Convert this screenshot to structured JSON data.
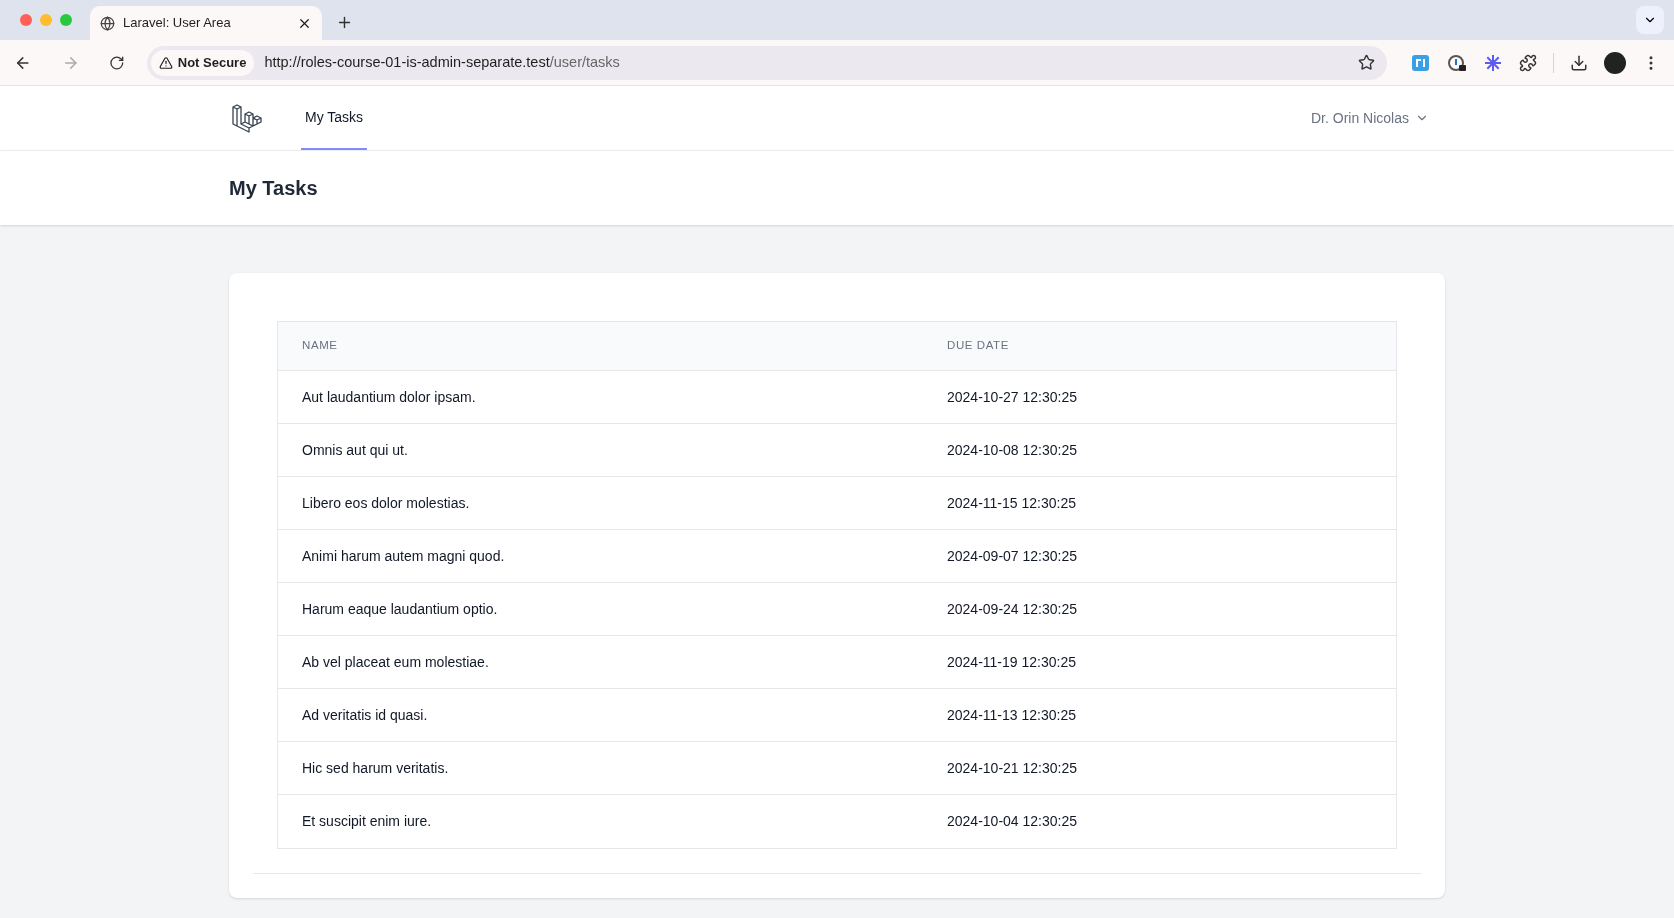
{
  "browser": {
    "tabs": [
      {
        "title": "Laravel: User Area",
        "selected": true
      }
    ],
    "security_label": "Not Secure",
    "url_host": "http://roles-course-01-is-admin-separate.test",
    "url_path": "/user/tasks"
  },
  "nav": {
    "links": [
      {
        "label": "My Tasks",
        "selected": true
      }
    ],
    "user_menu": "Dr. Orin Nicolas"
  },
  "page_title": "My Tasks",
  "table": {
    "columns": [
      "NAME",
      "DUE DATE"
    ],
    "rows": [
      [
        "Aut laudantium dolor ipsam.",
        "2024-10-27 12:30:25"
      ],
      [
        "Omnis aut qui ut.",
        "2024-10-08 12:30:25"
      ],
      [
        "Libero eos dolor molestias.",
        "2024-11-15 12:30:25"
      ],
      [
        "Animi harum autem magni quod.",
        "2024-09-07 12:30:25"
      ],
      [
        "Harum eaque laudantium optio.",
        "2024-09-24 12:30:25"
      ],
      [
        "Ab vel placeat eum molestiae.",
        "2024-11-19 12:30:25"
      ],
      [
        "Ad veritatis id quasi.",
        "2024-11-13 12:30:25"
      ],
      [
        "Hic sed harum veritatis.",
        "2024-10-21 12:30:25"
      ],
      [
        "Et suscipit enim iure.",
        "2024-10-04 12:30:25"
      ]
    ]
  }
}
